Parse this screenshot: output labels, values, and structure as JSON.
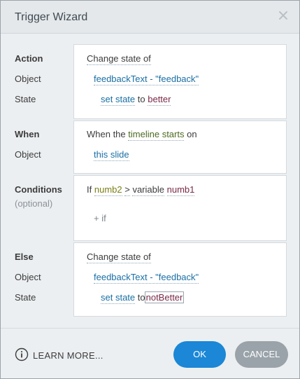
{
  "window": {
    "title": "Trigger Wizard",
    "close_icon": "close-icon"
  },
  "action": {
    "label": "Action",
    "object_label": "Object",
    "state_label": "State",
    "verb": "Change state of",
    "object": "feedbackText - \"feedback\"",
    "set_state": "set state",
    "to": "to",
    "state_value": "better"
  },
  "when": {
    "label": "When",
    "object_label": "Object",
    "prefix": "When the",
    "event": "timeline starts",
    "on": "on",
    "object": "this slide"
  },
  "conditions": {
    "label": "Conditions",
    "sublabel": "(optional)",
    "if": "If",
    "var1": "numb2",
    "operator": ">",
    "type": "variable",
    "var2": "numb1",
    "add_if": "+ if"
  },
  "else": {
    "label": "Else",
    "object_label": "Object",
    "state_label": "State",
    "verb": "Change state of",
    "object": "feedbackText - \"feedback\"",
    "set_state": "set state",
    "to": "to",
    "state_value": "notBetter"
  },
  "footer": {
    "learn_more": "LEARN MORE...",
    "ok": "OK",
    "cancel": "CANCEL",
    "info_icon": "info-icon"
  },
  "colors": {
    "ok_button": "#1b87d6",
    "cancel_button": "#9aa3aa",
    "link_blue": "#1a6fa5"
  }
}
